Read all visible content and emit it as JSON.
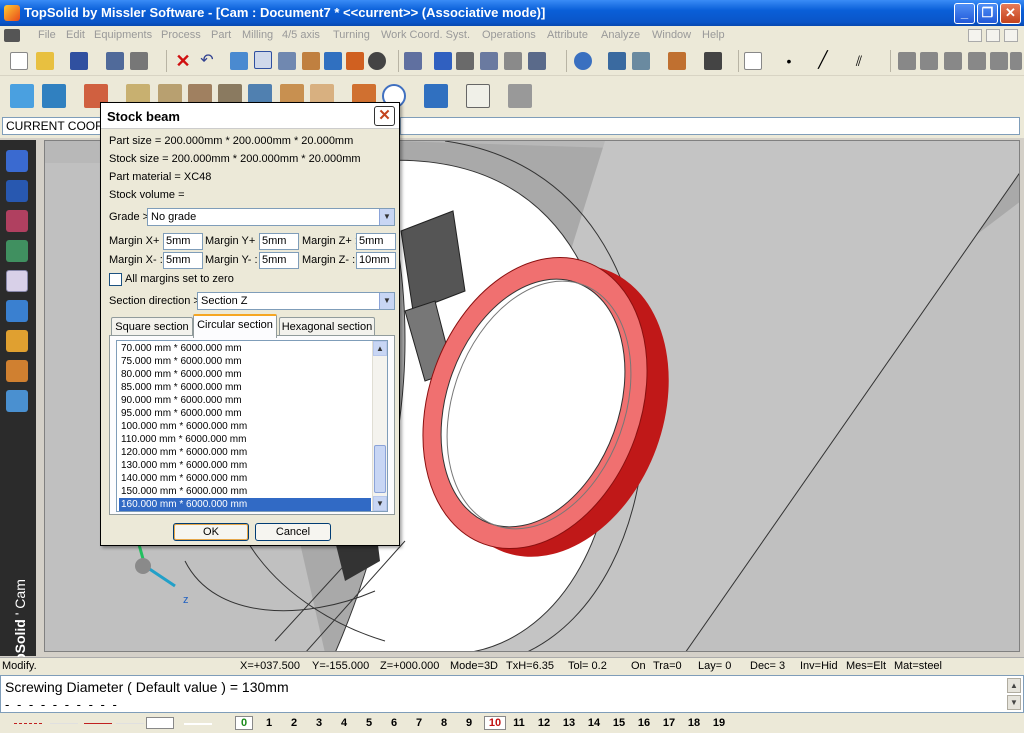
{
  "window": {
    "title": "TopSolid by Missler Software - [Cam : Document7 *  <<current>> (Associative mode)]",
    "minimize": "_",
    "restore": "❐",
    "close": "✕"
  },
  "menu": {
    "items": [
      "File",
      "Edit",
      "Equipments",
      "Process",
      "Part",
      "Milling",
      "4/5 axis",
      "Turning",
      "Work Coord. Syst.",
      "Operations",
      "Attribute",
      "Analyze",
      "Window",
      "Help"
    ]
  },
  "coordbar": {
    "value": "CURRENT COORD"
  },
  "leftbar": {
    "brand_bold": "TopSolid",
    "brand_suffix": "' Cam"
  },
  "axis_label": "z",
  "dialog": {
    "title": "Stock beam",
    "close": "✕",
    "part_size": "Part size = 200.000mm * 200.000mm * 20.000mm",
    "stock_size": "Stock size = 200.000mm * 200.000mm * 20.000mm",
    "part_material": "Part material = XC48",
    "stock_volume": "Stock volume =",
    "grade_label": "Grade >",
    "grade_value": "No grade",
    "margin_xp_label": "Margin X+ :",
    "margin_xp": "5mm",
    "margin_yp_label": "Margin Y+ :",
    "margin_yp": "5mm",
    "margin_zp_label": "Margin Z+ :",
    "margin_zp": "5mm",
    "margin_xm_label": "Margin X- :",
    "margin_xm": "5mm",
    "margin_ym_label": "Margin Y- :",
    "margin_ym": "5mm",
    "margin_zm_label": "Margin Z- :",
    "margin_zm": "10mm",
    "all_zero_label": "All margins set to zero",
    "all_zero_checked": false,
    "section_dir_label": "Section direction >",
    "section_dir_value": "Section Z",
    "tabs": [
      "Square section",
      "Circular section",
      "Hexagonal section"
    ],
    "active_tab": "Circular section",
    "list": [
      "70.000 mm * 6000.000 mm",
      "75.000 mm * 6000.000 mm",
      "80.000 mm * 6000.000 mm",
      "85.000 mm * 6000.000 mm",
      "90.000 mm * 6000.000 mm",
      "95.000 mm * 6000.000 mm",
      "100.000 mm * 6000.000 mm",
      "110.000 mm * 6000.000 mm",
      "120.000 mm * 6000.000 mm",
      "130.000 mm * 6000.000 mm",
      "140.000 mm * 6000.000 mm",
      "150.000 mm * 6000.000 mm",
      "160.000 mm * 6000.000 mm"
    ],
    "selected_item": "160.000 mm * 6000.000 mm",
    "ok": "OK",
    "cancel": "Cancel"
  },
  "status": {
    "mode": "Modify.",
    "x": "X=+037.500",
    "y": "Y=-155.000",
    "z": "Z=+000.000",
    "view": "Mode=3D",
    "txh": "TxH=6.35",
    "tol": "Tol=  0.2",
    "on": "On",
    "tra": "Tra=0",
    "lay": "Lay=  0",
    "dec": "Dec= 3",
    "inv": "Inv=Hid",
    "mes": "Mes=Elt",
    "mat": "Mat=steel"
  },
  "prompt": {
    "line1": "Screwing Diameter ( Default value ) = 130mm",
    "line2": "- - - - - - - - - -"
  },
  "layers": {
    "numbers": [
      "0",
      "1",
      "2",
      "3",
      "4",
      "5",
      "6",
      "7",
      "8",
      "9",
      "10",
      "11",
      "12",
      "13",
      "14",
      "15",
      "16",
      "17",
      "18",
      "19"
    ],
    "current": "0",
    "highlight": "10"
  },
  "colors": {
    "titlebar": "#0a5fd8",
    "ring_red": "#e8281e",
    "selection": "#316ac5",
    "background_3d": "#c0c0c0"
  }
}
